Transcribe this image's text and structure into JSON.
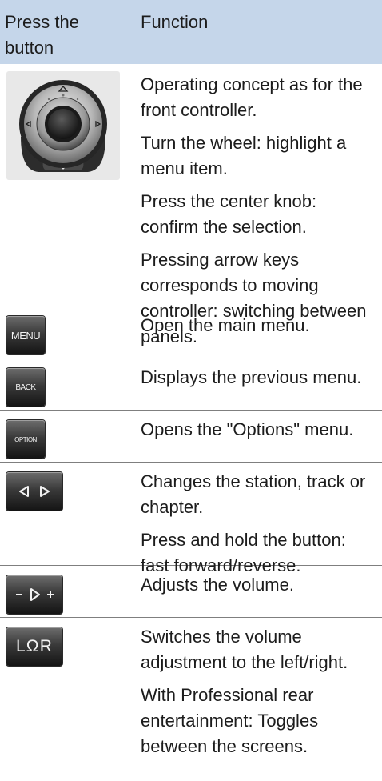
{
  "table": {
    "header": {
      "col1": "Press the button",
      "col2": "Function"
    },
    "rows": [
      {
        "icon": "controller-knob-icon",
        "paragraphs": [
          "Operating concept as for the front controller.",
          "Turn the wheel: highlight a menu item.",
          "Press the center knob: confirm the selection.",
          "Pressing arrow keys corresponds to moving controller: switching between panels."
        ]
      },
      {
        "icon": "menu-button-icon",
        "button_label": "MENU",
        "paragraphs": [
          "Open the main menu."
        ]
      },
      {
        "icon": "back-button-icon",
        "button_label": "BACK",
        "paragraphs": [
          "Displays the previous menu."
        ]
      },
      {
        "icon": "option-button-icon",
        "button_label": "OPTION",
        "paragraphs": [
          "Opens the \"Options\" menu."
        ]
      },
      {
        "icon": "prev-next-button-icon",
        "paragraphs": [
          "Changes the station, track or chapter.",
          "Press and hold the button: fast forward/reverse."
        ]
      },
      {
        "icon": "volume-button-icon",
        "paragraphs": [
          "Adjusts the volume."
        ]
      },
      {
        "icon": "headphone-lr-button-icon",
        "button_label": "LΩR",
        "paragraphs": [
          "Switches the volume adjustment to the left/right.",
          "With Professional rear entertainment: Toggles between the screens."
        ]
      }
    ]
  },
  "colors": {
    "header_bg": "#c5d6ea",
    "rule": "#7f7f7f",
    "text": "#1c1c1c",
    "controller_bg": "#e8e8e8"
  }
}
